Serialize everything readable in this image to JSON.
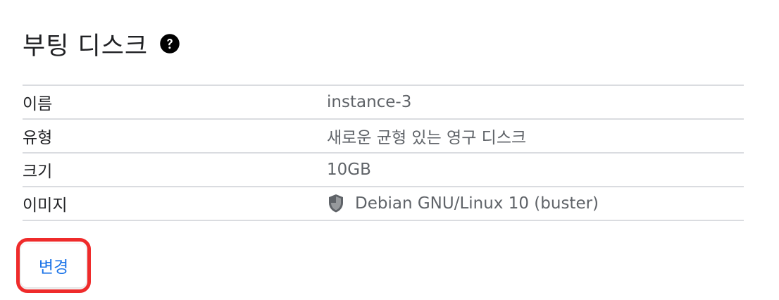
{
  "section": {
    "title": "부팅 디스크",
    "help_icon": "help-circle-icon"
  },
  "rows": [
    {
      "label": "이름",
      "value": "instance-3"
    },
    {
      "label": "유형",
      "value": "새로운 균형 있는 영구 디스크"
    },
    {
      "label": "크기",
      "value": "10GB"
    },
    {
      "label": "이미지",
      "value": "Debian GNU/Linux 10 (buster)",
      "icon": "shield-icon"
    }
  ],
  "actions": {
    "change_label": "변경"
  },
  "colors": {
    "highlight": "#ef2b2b",
    "link": "#1a73e8",
    "divider": "#dadce0"
  }
}
